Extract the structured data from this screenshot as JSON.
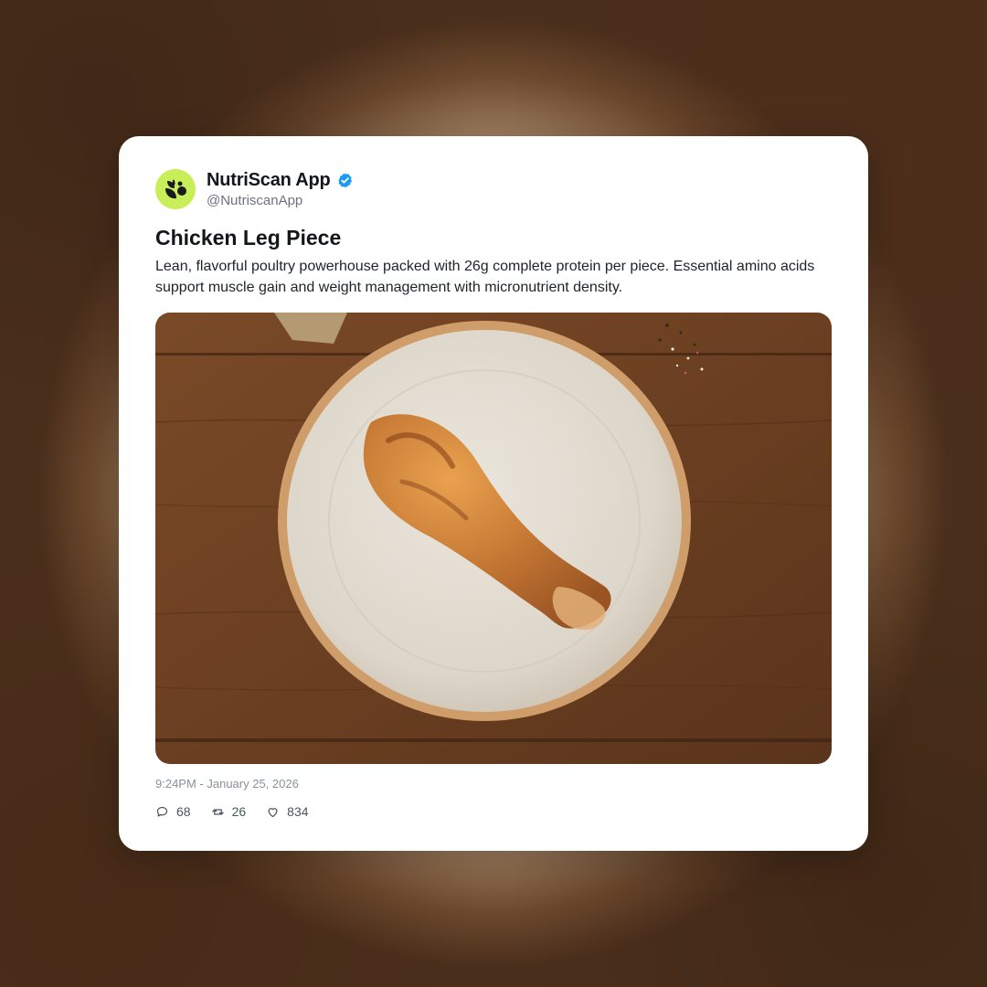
{
  "post": {
    "author_name": "NutriScan App",
    "author_handle": "@NutriscanApp",
    "verified": true,
    "title": "Chicken Leg Piece",
    "description": "Lean, flavorful poultry powerhouse packed with 26g complete protein per piece. Essential amino acids support muscle gain and weight management with micronutrient density.",
    "timestamp": "9:24PM - January 25, 2026",
    "image": "roasted chicken drumstick on ceramic plate on wooden table"
  },
  "stats": {
    "replies": "68",
    "reposts": "26",
    "likes": "834"
  },
  "icons": {
    "avatar": "leaf-logo-icon",
    "verified": "verified-badge-icon",
    "reply": "comment-icon",
    "repost": "repost-icon",
    "like": "heart-icon"
  },
  "colors": {
    "avatar_bg": "#c8ef5a",
    "verified": "#1d9bf0",
    "text": "#14171a",
    "muted": "#6b7280"
  }
}
